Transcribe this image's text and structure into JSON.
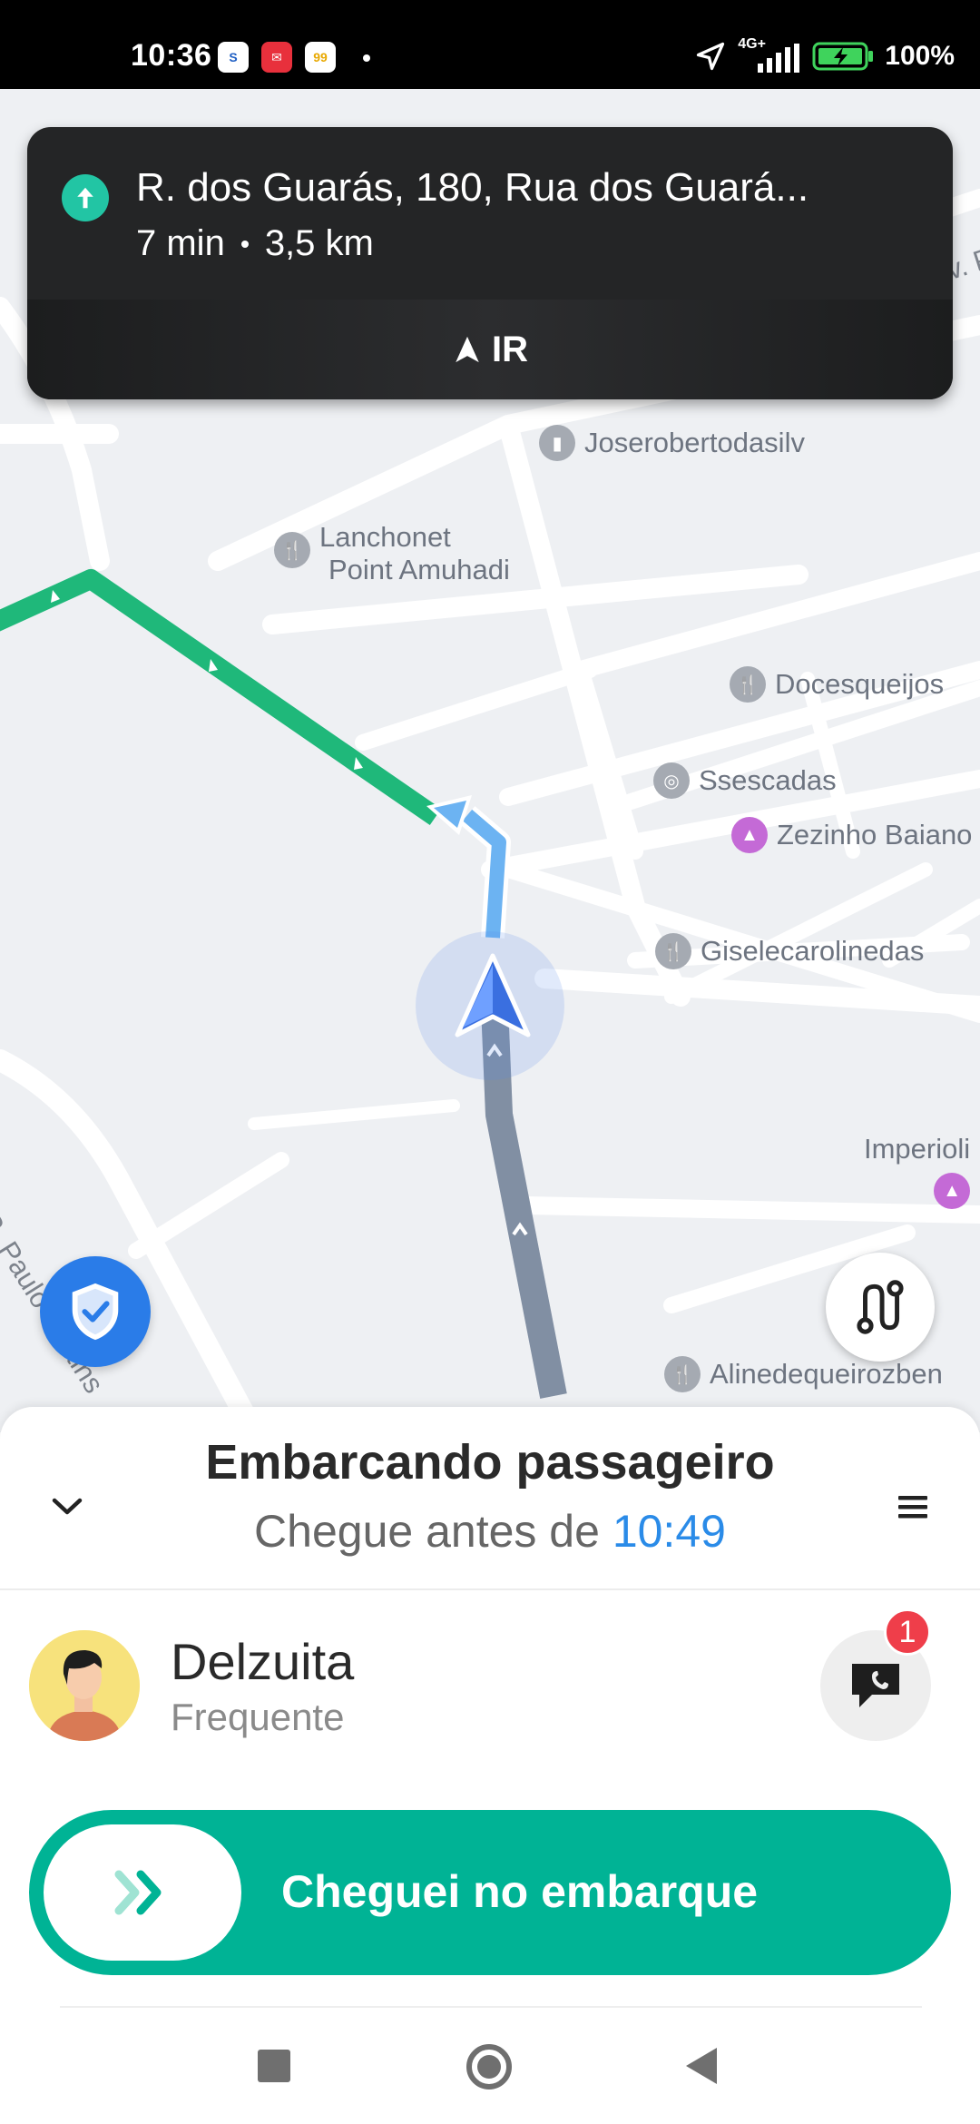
{
  "status_bar": {
    "time": "10:36",
    "network": "4G+",
    "battery": "100%",
    "notification_icons": [
      "samsung-pay-icon",
      "email-icon",
      "99-app-icon"
    ]
  },
  "navigation": {
    "address": "R. dos Guarás, 180, Rua dos Guará...",
    "duration": "7 min",
    "distance": "3,5 km",
    "go_label": "IR"
  },
  "map": {
    "route_color": "#1fb87a",
    "remaining_route_color": "#8d9aae",
    "pois": [
      {
        "name": "Joserobertodasilv",
        "icon": "shop-icon"
      },
      {
        "name_line1": "Lanchonet",
        "name_line2": "Point Amuhadi",
        "icon": "restaurant-icon"
      },
      {
        "name": "Docesqueijos",
        "icon": "restaurant-icon"
      },
      {
        "name": "Ssescadas",
        "icon": "car-icon"
      },
      {
        "name": "Zezinho Baiano",
        "icon": "shopping-bag-icon"
      },
      {
        "name": "Giselecarolinedas",
        "icon": "restaurant-icon"
      },
      {
        "name": "Imperioli",
        "icon": "shopping-bag-icon"
      },
      {
        "name": "Alinedequeirozben",
        "icon": "restaurant-icon"
      }
    ],
    "street_labels": [
      "Av. P",
      "R. Paulo Martins"
    ]
  },
  "trip": {
    "title": "Embarcando passageiro",
    "subtitle_prefix": "Chegue antes de ",
    "arrive_before": "10:49"
  },
  "passenger": {
    "name": "Delzuita",
    "tag": "Frequente",
    "unread_messages": "1"
  },
  "action": {
    "slide_label": "Cheguei no embarque",
    "accent_color": "#00b395"
  }
}
